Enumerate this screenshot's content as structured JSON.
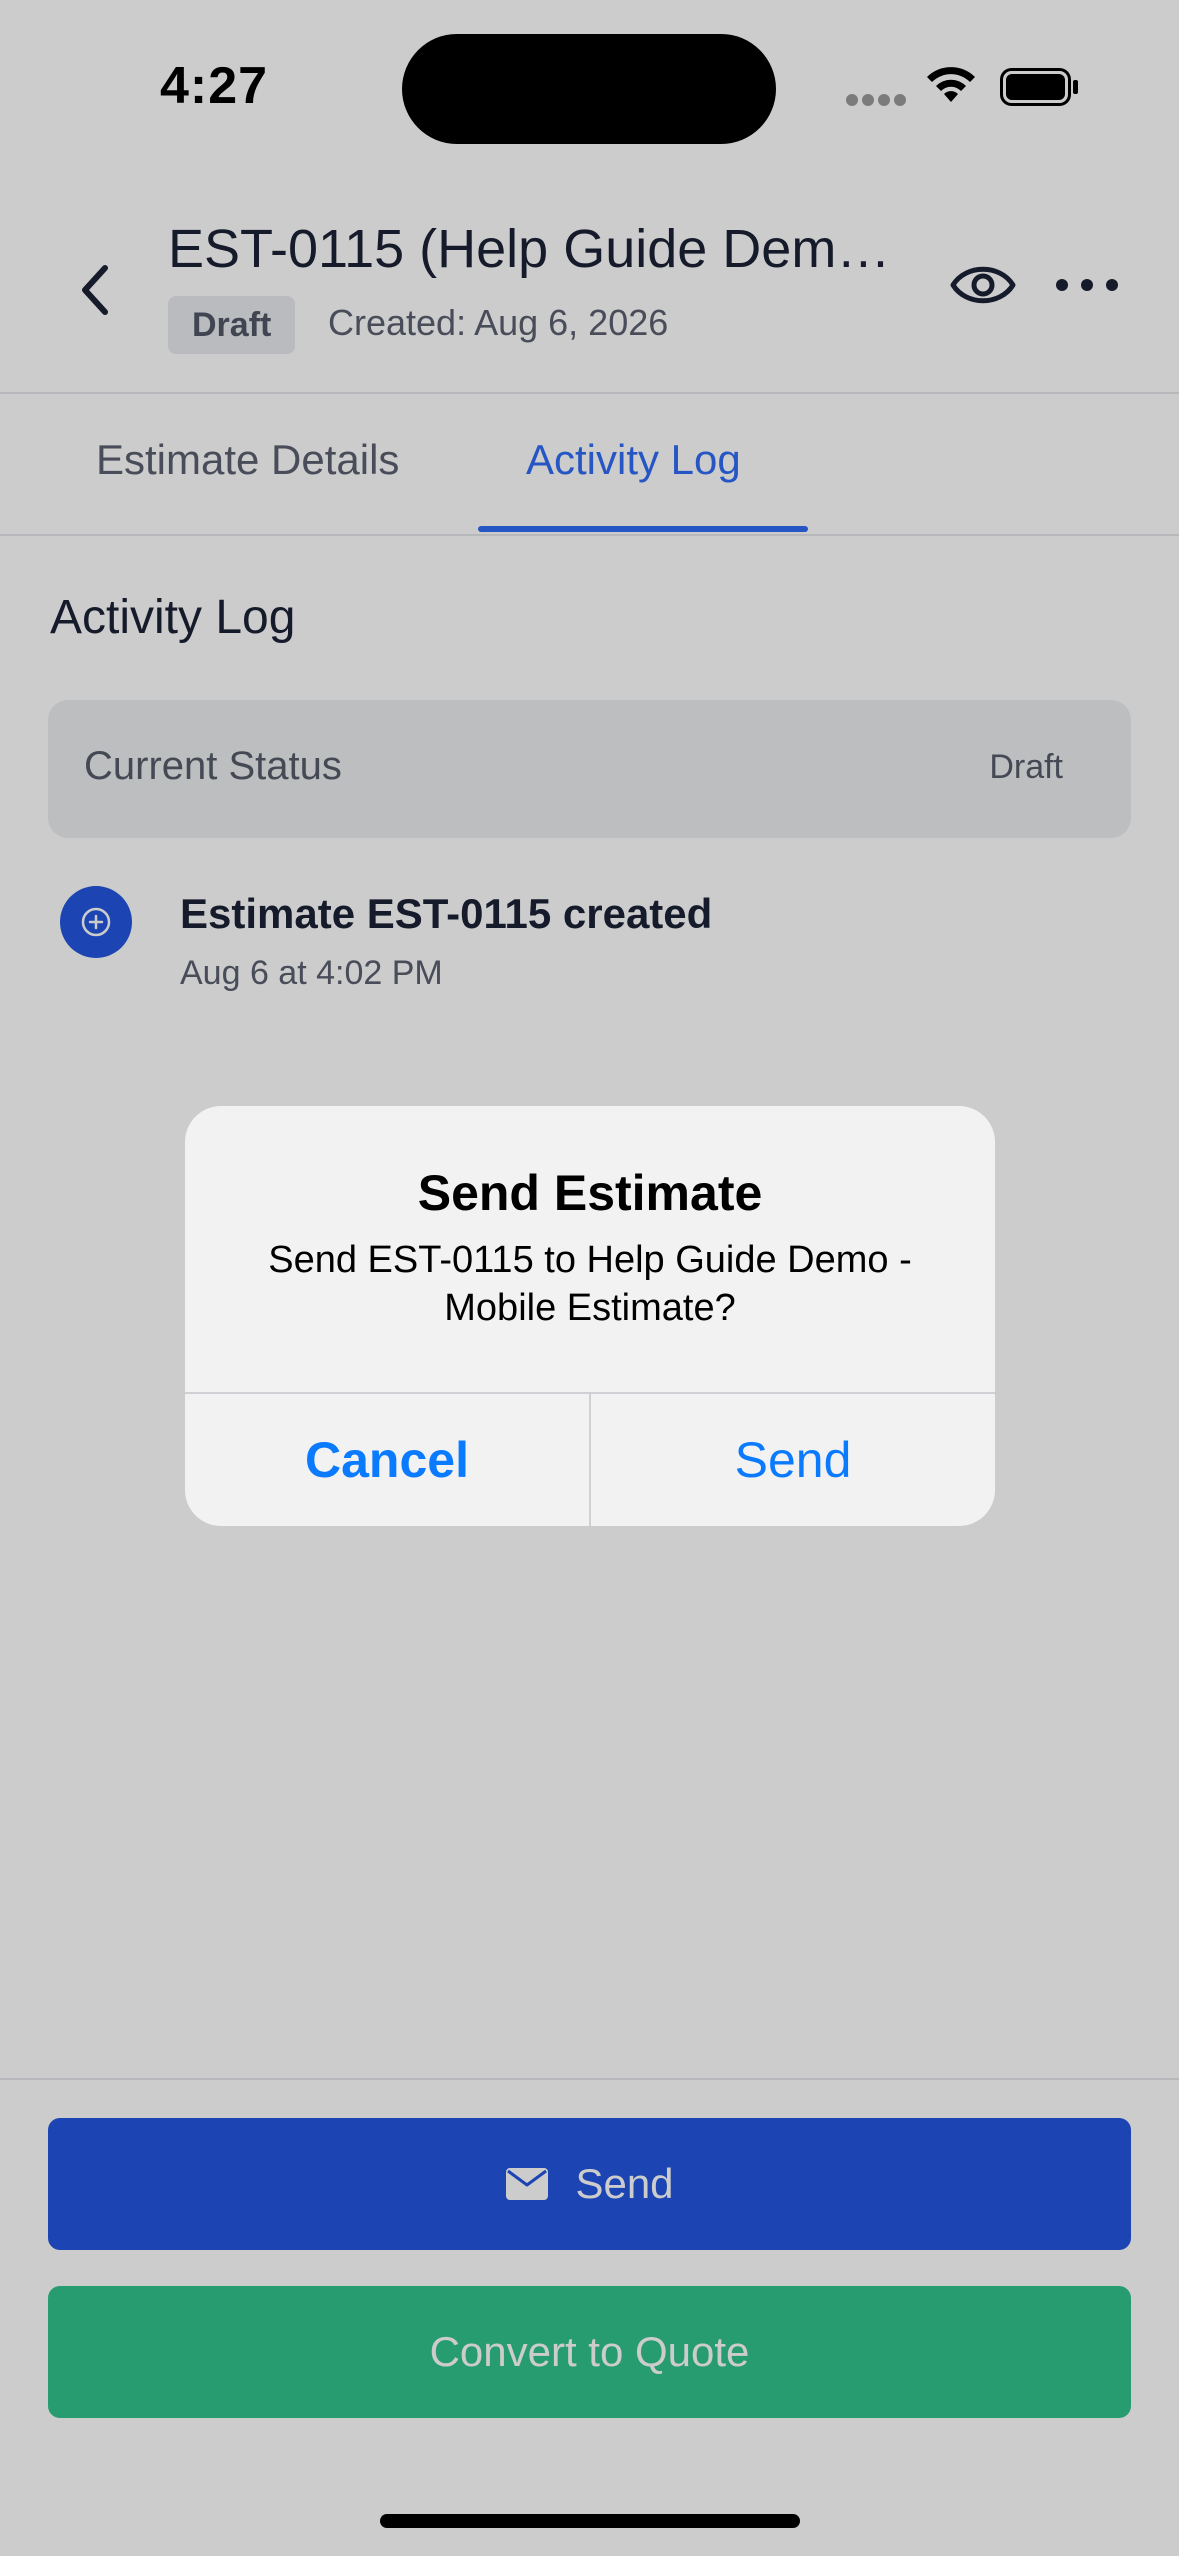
{
  "status_bar": {
    "time": "4:27"
  },
  "header": {
    "title": "EST-0115 (Help Guide Demo…",
    "badge": "Draft",
    "created": "Created: Aug 6, 2026"
  },
  "tabs": [
    {
      "label": "Estimate Details",
      "active": false
    },
    {
      "label": "Activity Log",
      "active": true
    }
  ],
  "activity": {
    "section_title": "Activity Log",
    "current_status_label": "Current Status",
    "current_status_value": "Draft",
    "entries": [
      {
        "title": "Estimate EST-0115 created",
        "time": "Aug 6 at 4:02 PM",
        "icon": "plus-circle-icon"
      }
    ]
  },
  "actions": {
    "send_label": "Send",
    "convert_label": "Convert to Quote"
  },
  "dialog": {
    "title": "Send Estimate",
    "message": "Send EST-0115 to Help Guide Demo - Mobile Estimate?",
    "cancel_label": "Cancel",
    "confirm_label": "Send"
  },
  "colors": {
    "primary": "#2456e0",
    "tab_active": "#2f6cf5",
    "success": "#31c48d",
    "ios_link": "#0a7aff"
  }
}
